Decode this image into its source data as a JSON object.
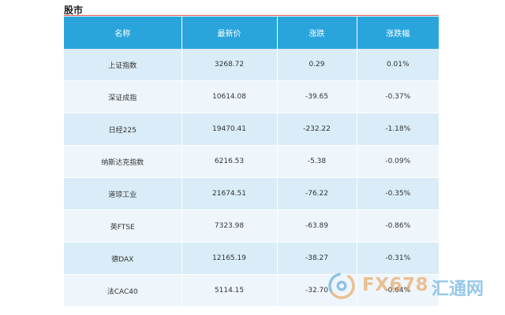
{
  "section": {
    "title": "股市"
  },
  "table": {
    "headers": [
      "名称",
      "最新价",
      "涨跌",
      "涨跌幅"
    ],
    "rows": [
      {
        "name": "上证指数",
        "price": "3268.72",
        "change": "0.29",
        "pct": "0.01%"
      },
      {
        "name": "深证成指",
        "price": "10614.08",
        "change": "-39.65",
        "pct": "-0.37%"
      },
      {
        "name": "日经225",
        "price": "19470.41",
        "change": "-232.22",
        "pct": "-1.18%"
      },
      {
        "name": "纳斯达克指数",
        "price": "6216.53",
        "change": "-5.38",
        "pct": "-0.09%"
      },
      {
        "name": "道琼工业",
        "price": "21674.51",
        "change": "-76.22",
        "pct": "-0.35%"
      },
      {
        "name": "英FTSE",
        "price": "7323.98",
        "change": "-63.89",
        "pct": "-0.86%"
      },
      {
        "name": "德DAX",
        "price": "12165.19",
        "change": "-38.27",
        "pct": "-0.31%"
      },
      {
        "name": "法CAC40",
        "price": "5114.15",
        "change": "-32.70",
        "pct": "-0.64%"
      }
    ]
  },
  "watermark": {
    "brand": "FX678",
    "cn": "汇通网"
  },
  "colors": {
    "header_bg": "#2aa5dc",
    "row_odd": "#d9ecf7",
    "row_even": "#eef6fc",
    "title_rule": "#d9534f",
    "watermark_orange": "#e8933b",
    "watermark_blue": "#3f9bd6"
  }
}
